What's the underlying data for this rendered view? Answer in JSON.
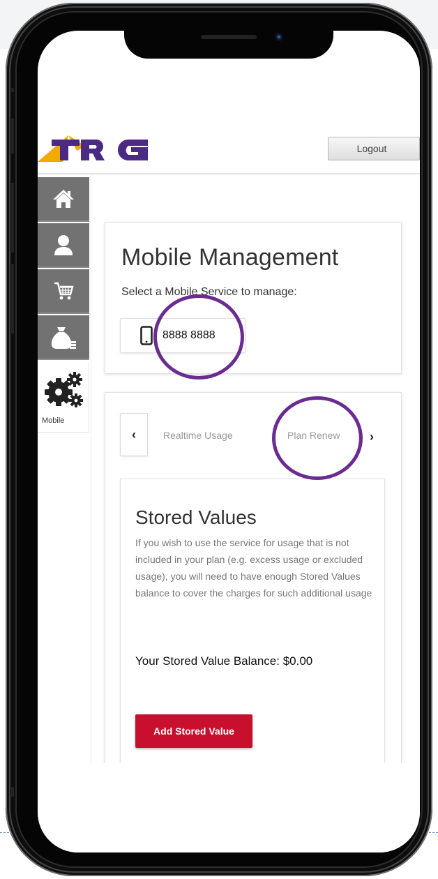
{
  "header": {
    "logo_text": "TPG",
    "logout_label": "Logout"
  },
  "sidebar": {
    "items": [
      {
        "icon": "home-icon"
      },
      {
        "icon": "user-icon"
      },
      {
        "icon": "cart-icon"
      },
      {
        "icon": "money-bag-icon"
      },
      {
        "icon": "gears-icon",
        "label": "Mobile"
      }
    ]
  },
  "mobile_management": {
    "title": "Mobile Management",
    "subtitle": "Select a Mobile Service to manage:",
    "service_number": "8888 8888"
  },
  "tabs": {
    "items": [
      {
        "label": "Realtime Usage"
      },
      {
        "label": "Plan Renew"
      }
    ]
  },
  "stored_values": {
    "title": "Stored Values",
    "description": "If you wish to use the service for usage that is not included in your plan (e.g. excess usage or excluded usage), you will need to have enough Stored Values balance to cover the charges for such additional usage",
    "balance_text": "Your Stored Value Balance: $0.00",
    "add_button_label": "Add Stored Value"
  },
  "colors": {
    "accent_red": "#c8102e",
    "logo_purple": "#4b2a84",
    "logo_orange": "#f2a900",
    "highlight_purple": "#6a2c91",
    "sidebar_gray": "#727272"
  }
}
